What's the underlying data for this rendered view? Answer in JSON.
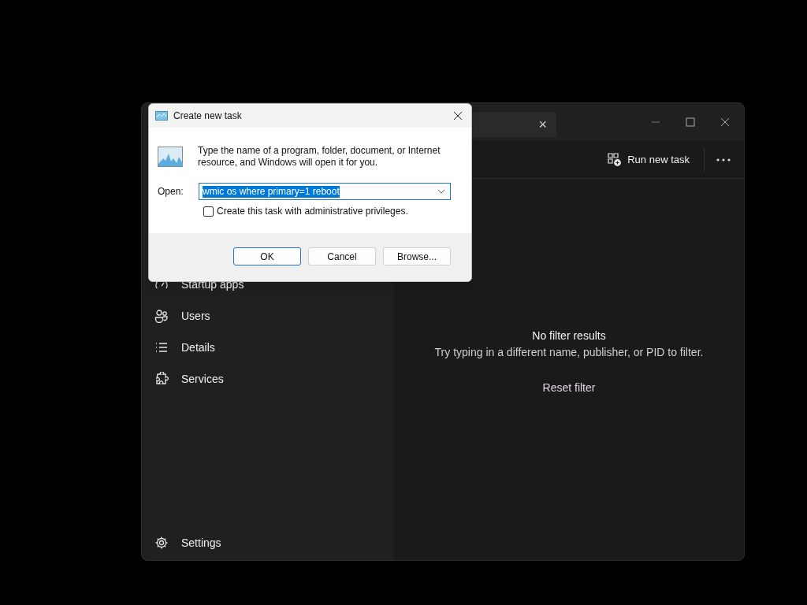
{
  "task_manager": {
    "tab": {
      "close": "×"
    },
    "toolbar": {
      "run_new_task": "Run new task"
    },
    "sidebar": {
      "items": [
        {
          "kind": "startup",
          "label": "Startup apps"
        },
        {
          "kind": "users",
          "label": "Users"
        },
        {
          "kind": "details",
          "label": "Details"
        },
        {
          "kind": "services",
          "label": "Services"
        }
      ],
      "settings": {
        "label": "Settings"
      }
    },
    "empty_state": {
      "title": "No filter results",
      "message": "Try typing in a different name, publisher, or PID to filter.",
      "reset": "Reset filter"
    }
  },
  "dialog": {
    "title": "Create new task",
    "message": "Type the name of a program, folder, document, or Internet resource, and Windows will open it for you.",
    "open_label": "Open:",
    "open_value": "wmic os where primary=1 reboot",
    "value_selected": true,
    "admin_checkbox": {
      "label": "Create this task with administrative privileges.",
      "checked": false
    },
    "buttons": [
      {
        "label": "OK",
        "default": true
      },
      {
        "label": "Cancel",
        "default": false
      },
      {
        "label": "Browse...",
        "default": false
      }
    ]
  }
}
